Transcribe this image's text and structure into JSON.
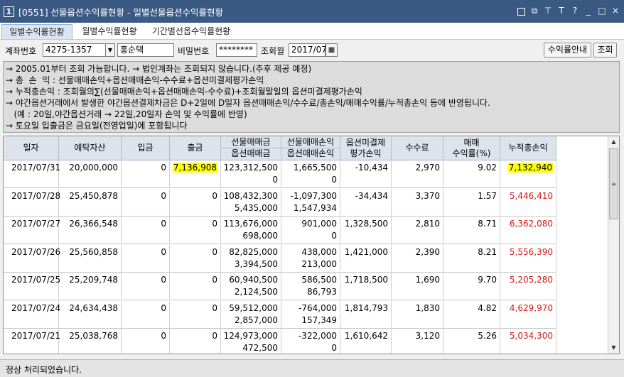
{
  "window": {
    "number": "1",
    "title": "[0551] 선물옵션수익률현황 - 일별선물옵션수익률현황",
    "controls": [
      "▣",
      "⧉",
      "⊤",
      "T",
      "?",
      "_",
      "□",
      "×"
    ]
  },
  "tabs": [
    "일별수익률현황",
    "월별수익률현황",
    "기간별선옵수익률현황"
  ],
  "form": {
    "account_label": "계좌번호",
    "account_value": "4275-1357",
    "account_name": "홍순택",
    "password_label": "비밀번호",
    "password_value": "********",
    "month_label": "조회월",
    "month_value": "2017/07",
    "guide_button": "수익률안내",
    "search_button": "조회"
  },
  "notice": [
    "→ 2005.01부터 조회 가능합니다. → 법인계좌는 조회되지 않습니다.(추후 제공 예정)",
    "→ 총  손  익 : 선물매매손익+옵션매매손익-수수료+옵션미결제평가손익",
    "→ 누적총손익 : 조회월의∑(선물매매손익+옵션매매손익-수수료)+조회월말일의 옵션미결제평가손익",
    "→ 야간옵션거래에서 발생한 야간옵션결제차금은 D+2일에 D일자 옵션매매손익/수수료/총손익/매매수익률/누적총손익 등에 반영됩니다.",
    "   (예 : 20일,야간옵션거래 → 22일,20일자 손익 및 수익률에 반영)",
    "→ 토요일 입출금은 금요일(전영업일)에 포함됩니다"
  ],
  "table": {
    "headers": [
      [
        "일자"
      ],
      [
        "예탁자산"
      ],
      [
        "입금"
      ],
      [
        "출금"
      ],
      [
        "선물매매금",
        "옵션매매금"
      ],
      [
        "선물매매손익",
        "옵션매매손익"
      ],
      [
        "옵션미결제",
        "평가손익"
      ],
      [
        "수수료"
      ],
      [
        "매매",
        "수익률(%)"
      ],
      [
        "누적총손익"
      ]
    ],
    "rows": [
      {
        "date": "2017/07/31",
        "asset": "20,000,000",
        "deposit": "0",
        "withdraw": "7,136,908",
        "fut_amt": "123,312,500",
        "opt_amt": "0",
        "fut_pl": "1,665,500",
        "opt_pl": "0",
        "unsettled": "-10,434",
        "fee": "2,970",
        "rate": "9.02",
        "cum": "7,132,940"
      },
      {
        "date": "2017/07/28",
        "asset": "25,450,878",
        "deposit": "0",
        "withdraw": "0",
        "fut_amt": "108,432,300",
        "opt_amt": "5,435,000",
        "fut_pl": "-1,097,300",
        "opt_pl": "1,547,934",
        "unsettled": "-34,434",
        "fee": "3,370",
        "rate": "1.57",
        "cum": "5,446,410"
      },
      {
        "date": "2017/07/27",
        "asset": "26,366,548",
        "deposit": "0",
        "withdraw": "0",
        "fut_amt": "113,676,000",
        "opt_amt": "698,000",
        "fut_pl": "901,000",
        "opt_pl": "0",
        "unsettled": "1,328,500",
        "fee": "2,810",
        "rate": "8.71",
        "cum": "6,362,080"
      },
      {
        "date": "2017/07/26",
        "asset": "25,560,858",
        "deposit": "0",
        "withdraw": "0",
        "fut_amt": "82,825,000",
        "opt_amt": "3,394,500",
        "fut_pl": "438,000",
        "opt_pl": "213,000",
        "unsettled": "1,421,000",
        "fee": "2,390",
        "rate": "8.21",
        "cum": "5,556,390"
      },
      {
        "date": "2017/07/25",
        "asset": "25,209,748",
        "deposit": "0",
        "withdraw": "0",
        "fut_amt": "60,940,500",
        "opt_amt": "2,124,500",
        "fut_pl": "586,500",
        "opt_pl": "86,793",
        "unsettled": "1,718,500",
        "fee": "1,690",
        "rate": "9.70",
        "cum": "5,205,280"
      },
      {
        "date": "2017/07/24",
        "asset": "24,634,438",
        "deposit": "0",
        "withdraw": "0",
        "fut_amt": "59,512,000",
        "opt_amt": "2,857,000",
        "fut_pl": "-764,000",
        "opt_pl": "157,349",
        "unsettled": "1,814,793",
        "fee": "1,830",
        "rate": "4.82",
        "cum": "4,629,970"
      },
      {
        "date": "2017/07/21",
        "asset": "25,038,768",
        "deposit": "0",
        "withdraw": "0",
        "fut_amt": "124,973,000",
        "opt_amt": "472,500",
        "fut_pl": "-322,000",
        "opt_pl": "0",
        "unsettled": "1,610,642",
        "fee": "3,120",
        "rate": "5.26",
        "cum": "5,034,300"
      }
    ]
  },
  "status": "정상 처리되었습니다.",
  "colors": {
    "titlebar": "#3a5a84",
    "header_bg": "#dde3ec",
    "positive_red": "#d01818",
    "highlight": "#ffff00"
  }
}
